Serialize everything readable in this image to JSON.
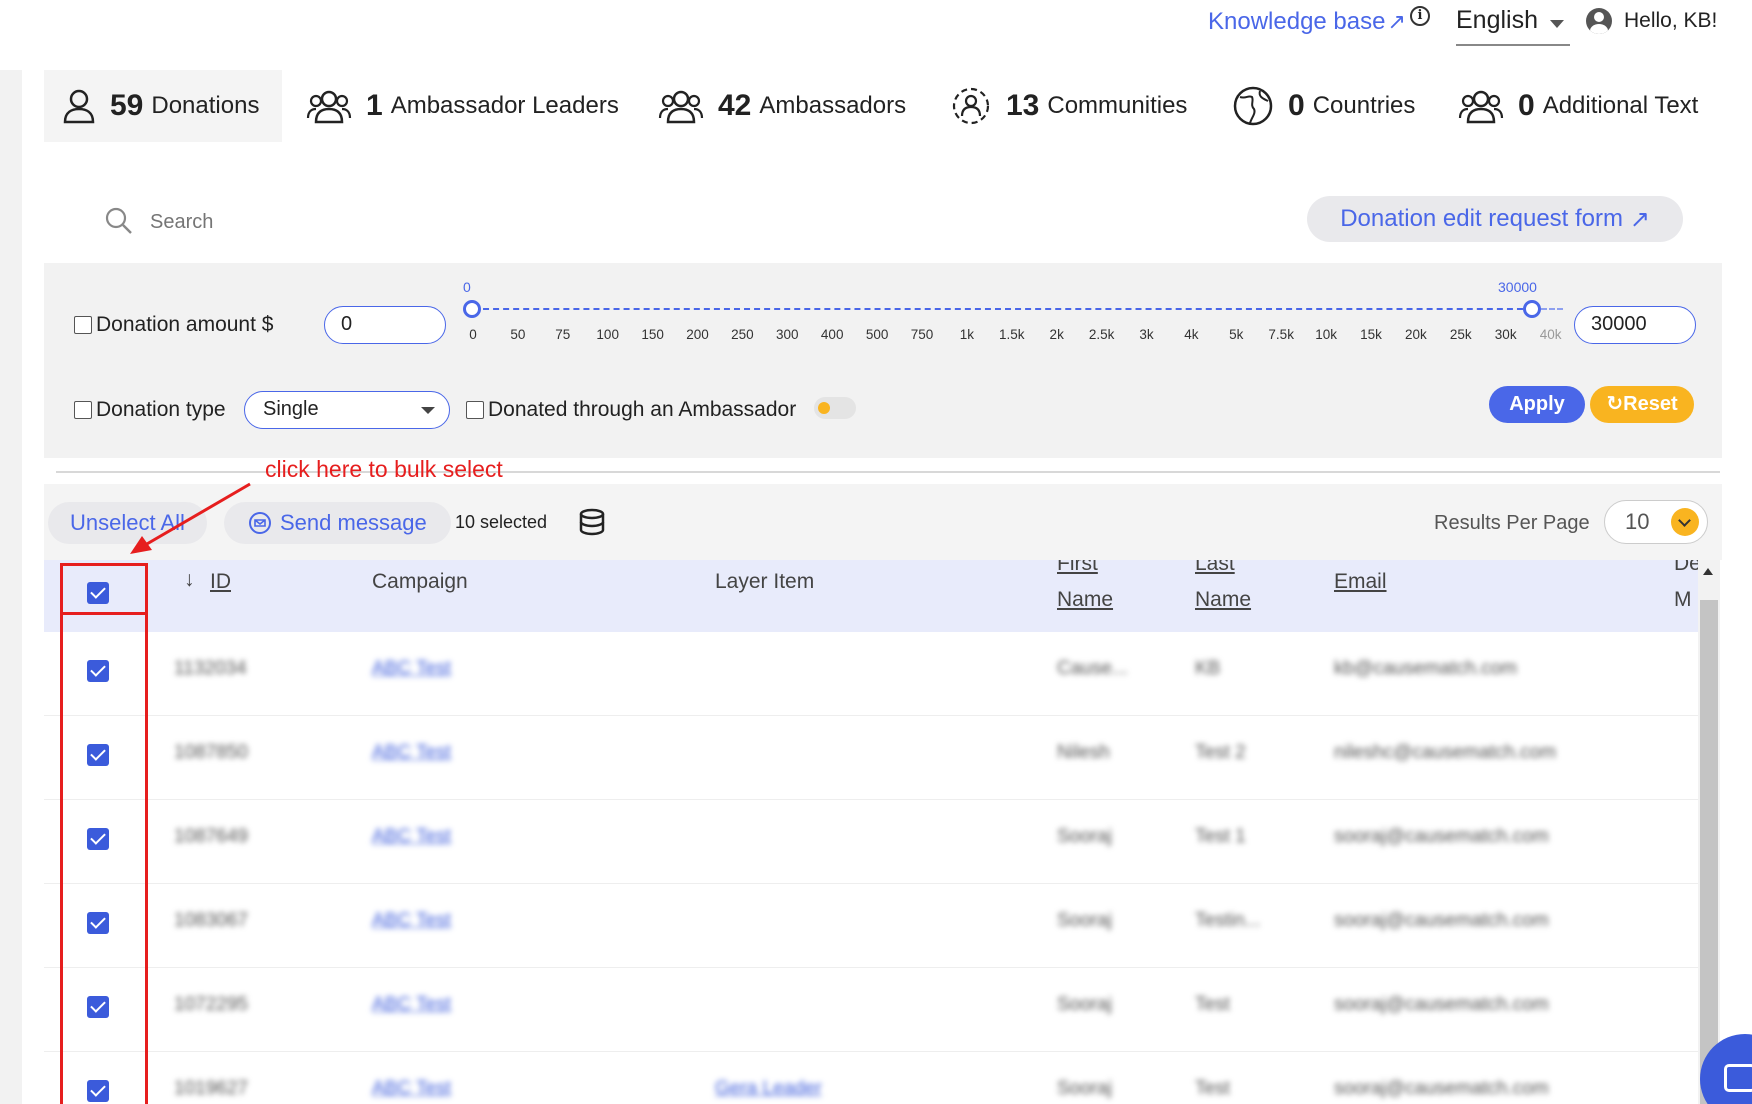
{
  "header": {
    "knowledge_base": "Knowledge base",
    "language": "English",
    "greeting": "Hello, KB!"
  },
  "stats": [
    {
      "count": "59",
      "label": "Donations",
      "icon": "person-icon"
    },
    {
      "count": "1",
      "label": "Ambassador Leaders",
      "icon": "group-icon"
    },
    {
      "count": "42",
      "label": "Ambassadors",
      "icon": "group-icon"
    },
    {
      "count": "13",
      "label": "Communities",
      "icon": "community-icon"
    },
    {
      "count": "0",
      "label": "Countries",
      "icon": "globe-icon"
    },
    {
      "count": "0",
      "label": "Additional Text",
      "icon": "group-icon"
    }
  ],
  "search": {
    "placeholder": "Search"
  },
  "edit_request_form": "Donation edit request form",
  "filters": {
    "amount_label": "Donation amount $",
    "min_value": "0",
    "max_value": "30000",
    "slider_min_label": "0",
    "slider_max_label": "30000",
    "slider_ticks": [
      "0",
      "50",
      "75",
      "100",
      "150",
      "200",
      "250",
      "300",
      "400",
      "500",
      "750",
      "1k",
      "1.5k",
      "2k",
      "2.5k",
      "3k",
      "4k",
      "5k",
      "7.5k",
      "10k",
      "15k",
      "20k",
      "25k",
      "30k",
      "40k"
    ],
    "type_label": "Donation type",
    "type_value": "Single",
    "ambassador_label": "Donated through an Ambassador",
    "apply": "Apply",
    "reset": "Reset"
  },
  "annotation": "click here to bulk select",
  "toolbar": {
    "unselect_all": "Unselect All",
    "send_message": "Send message",
    "selected": "10 selected",
    "results_per_page_label": "Results Per Page",
    "results_per_page": "10"
  },
  "table": {
    "columns": {
      "id": "ID",
      "campaign": "Campaign",
      "layer_item": "Layer Item",
      "first_name_1": "First",
      "first_name_2": "Name",
      "last_name_1": "Last",
      "last_name_2": "Name",
      "email": "Email",
      "de_1": "De",
      "de_2": "M"
    },
    "rows": [
      {
        "id": "1132034",
        "campaign": "ABC Test",
        "layer": "",
        "first": "Cause...",
        "last": "KB",
        "email": "kb@causematch.com"
      },
      {
        "id": "1087850",
        "campaign": "ABC Test",
        "layer": "",
        "first": "Nilesh",
        "last": "Test 2",
        "email": "nileshc@causematch.com"
      },
      {
        "id": "1087649",
        "campaign": "ABC Test",
        "layer": "",
        "first": "Sooraj",
        "last": "Test 1",
        "email": "sooraj@causematch.com"
      },
      {
        "id": "1083067",
        "campaign": "ABC Test",
        "layer": "",
        "first": "Sooraj",
        "last": "Testin...",
        "email": "sooraj@causematch.com"
      },
      {
        "id": "1072295",
        "campaign": "ABC Test",
        "layer": "",
        "first": "Sooraj",
        "last": "Test",
        "email": "sooraj@causematch.com"
      },
      {
        "id": "1019627",
        "campaign": "ABC Test",
        "layer": "Gera Leader",
        "first": "Sooraj",
        "last": "Test",
        "email": "sooraj@causematch.com"
      }
    ]
  },
  "colors": {
    "accent": "#4a67e8",
    "warning": "#f9b420",
    "annotation": "#e61e1e"
  }
}
